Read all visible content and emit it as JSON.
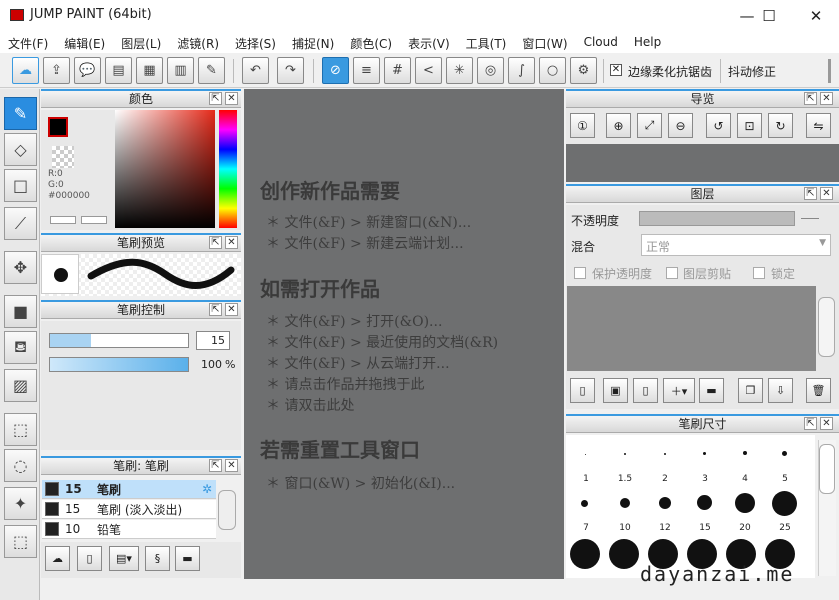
{
  "window": {
    "title": "JUMP PAINT (64bit)",
    "minimize": "—",
    "maximize": "☐",
    "close": "✕"
  },
  "menu": [
    "文件(F)",
    "编辑(E)",
    "图层(L)",
    "滤镜(R)",
    "选择(S)",
    "捕捉(N)",
    "颜色(C)",
    "表示(V)",
    "工具(T)",
    "窗口(W)",
    "Cloud",
    "Help"
  ],
  "toolbar": {
    "antialias_label": "边缘柔化抗锯齿",
    "stabilizer_label": "抖动修正"
  },
  "color_panel": {
    "title": "颜色",
    "r": "R:0",
    "g": "G:0",
    "hex": "#000000"
  },
  "brush_preview": {
    "title": "笔刷预览"
  },
  "brush_control": {
    "title": "笔刷控制",
    "size_value": "15",
    "opacity_value": "100",
    "opacity_unit": "%",
    "size_fraction": 0.3,
    "opacity_fraction": 1.0
  },
  "brush_list": {
    "title": "笔刷: 笔刷",
    "items": [
      {
        "size": "15",
        "name": "笔刷"
      },
      {
        "size": "15",
        "name": "笔刷 (淡入淡出)"
      },
      {
        "size": "10",
        "name": "铅笔"
      }
    ]
  },
  "canvas": {
    "heading1": "创作新作品需要",
    "items1": [
      "＊ 文件(&F) > 新建窗口(&N)...",
      "＊ 文件(&F) > 新建云端计划..."
    ],
    "heading2": "如需打开作品",
    "items2": [
      "＊ 文件(&F) > 打开(&O)...",
      "＊ 文件(&F) > 最近使用的文档(&R)",
      "＊ 文件(&F) > 从云端打开...",
      "＊ 请点击作品并拖拽于此",
      "＊ 请双击此处"
    ],
    "heading3": "若需重置工具窗口",
    "items3": [
      "＊ 窗口(&W) > 初始化(&I)..."
    ]
  },
  "navigator": {
    "title": "导览"
  },
  "layers": {
    "title": "图层",
    "opacity_label": "不透明度",
    "blend_label": "混合",
    "blend_value": "正常",
    "protect_label": "保护透明度",
    "clip_label": "图层剪贴",
    "lock_label": "锁定"
  },
  "brush_size": {
    "title": "笔刷尺寸",
    "sizes": [
      "1",
      "1.5",
      "2",
      "3",
      "4",
      "5",
      "7",
      "10",
      "12",
      "15",
      "20",
      "25"
    ]
  },
  "watermark": "dayanzai.me"
}
